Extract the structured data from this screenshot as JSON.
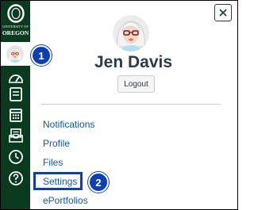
{
  "sidebar": {
    "logo": {
      "letter": "O",
      "line1": "UNIVERSITY OF",
      "line2": "OREGON"
    },
    "nav": [
      {
        "icon": "account-avatar-icon",
        "active": true
      },
      {
        "icon": "dashboard-icon"
      },
      {
        "icon": "courses-icon"
      },
      {
        "icon": "calendar-icon"
      },
      {
        "icon": "inbox-icon"
      },
      {
        "icon": "history-icon"
      },
      {
        "icon": "help-icon"
      }
    ]
  },
  "tray": {
    "close_icon": "close-icon",
    "user_name": "Jen Davis",
    "logout_label": "Logout",
    "links": [
      "Notifications",
      "Profile",
      "Files",
      "Settings",
      "ePortfolios"
    ],
    "highlighted_link": "Settings"
  },
  "callouts": {
    "first": "1",
    "second": "2"
  },
  "colors": {
    "sidebar": "#0a3b1f",
    "logo_yellow": "#fce122",
    "link": "#0b5aa8",
    "callout": "#0c3fb3",
    "name_text": "#2d3b45"
  }
}
